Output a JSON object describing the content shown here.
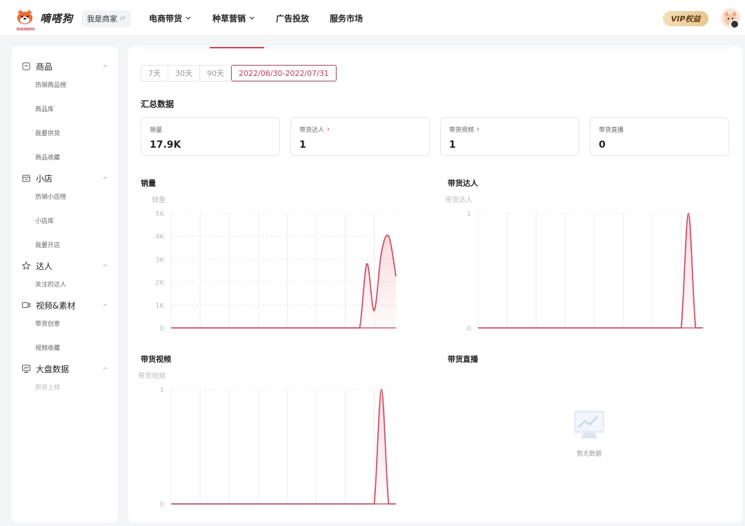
{
  "header": {
    "logo_text": "嘀嗒狗",
    "logo_sub": "DIDADOG",
    "role_label": "我是商家",
    "nav": [
      {
        "label": "电商带货",
        "dropdown": true
      },
      {
        "label": "种草营销",
        "dropdown": true
      },
      {
        "label": "广告投放",
        "dropdown": false
      },
      {
        "label": "服务市场",
        "dropdown": false
      }
    ],
    "vip_label": "VIP权益"
  },
  "sidebar": {
    "groups": [
      {
        "label": "商品",
        "icon": "product-icon",
        "items": [
          "热销商品榜",
          "商品库",
          "我要供货",
          "商品收藏"
        ]
      },
      {
        "label": "小店",
        "icon": "shop-icon",
        "items": [
          "热销小店榜",
          "小店库",
          "我要开店"
        ]
      },
      {
        "label": "达人",
        "icon": "influencer-icon",
        "items": [
          "关注的达人"
        ]
      },
      {
        "label": "视频&素材",
        "icon": "video-icon",
        "items": [
          "带货创意",
          "视频收藏"
        ]
      },
      {
        "label": "大盘数据",
        "icon": "dashboard-icon",
        "items": [
          "即将上线"
        ]
      }
    ]
  },
  "main": {
    "date_options": [
      "7天",
      "30天",
      "90天"
    ],
    "date_range": "2022/06/30-2022/07/31",
    "summary_title": "汇总数据",
    "cards": [
      {
        "label": "销量",
        "value": "17.9K",
        "has_more": false
      },
      {
        "label": "带货达人",
        "value": "1",
        "has_more": true
      },
      {
        "label": "带货视频",
        "value": "1",
        "has_more": true
      },
      {
        "label": "带货直播",
        "value": "0",
        "has_more": false
      }
    ],
    "more_symbol": "›",
    "empty_text": "暂无数据"
  },
  "chart_data": [
    {
      "type": "area",
      "title": "销量",
      "ylabel": "销量",
      "y_ticks": [
        "0",
        "1K",
        "2K",
        "3K",
        "4K",
        "5K"
      ],
      "ylim": [
        0,
        5000
      ],
      "x": [
        0,
        1,
        2,
        3,
        4,
        5,
        6,
        7,
        8,
        9,
        10,
        11,
        12,
        13,
        14,
        15,
        16,
        17,
        18,
        19,
        20,
        21,
        22,
        23,
        24,
        25,
        26,
        27,
        28,
        29,
        30,
        31
      ],
      "values": [
        0,
        0,
        0,
        0,
        0,
        0,
        0,
        0,
        0,
        0,
        0,
        0,
        0,
        0,
        0,
        0,
        0,
        0,
        0,
        0,
        0,
        0,
        0,
        0,
        0,
        0,
        0,
        2800,
        750,
        3300,
        4000,
        2250
      ],
      "grid": true
    },
    {
      "type": "area",
      "title": "带货达人",
      "ylabel": "带货达人",
      "y_ticks": [
        "0",
        "1"
      ],
      "ylim": [
        0,
        1
      ],
      "x": [
        0,
        1,
        2,
        3,
        4,
        5,
        6,
        7,
        8,
        9,
        10,
        11,
        12,
        13,
        14,
        15,
        16,
        17,
        18,
        19,
        20,
        21,
        22,
        23,
        24,
        25,
        26,
        27,
        28,
        29,
        30,
        31
      ],
      "values": [
        0,
        0,
        0,
        0,
        0,
        0,
        0,
        0,
        0,
        0,
        0,
        0,
        0,
        0,
        0,
        0,
        0,
        0,
        0,
        0,
        0,
        0,
        0,
        0,
        0,
        0,
        0,
        0,
        0,
        1,
        0,
        0
      ],
      "grid": true
    },
    {
      "type": "area",
      "title": "带货视频",
      "ylabel": "带货视频",
      "y_ticks": [
        "0",
        "1"
      ],
      "ylim": [
        0,
        1
      ],
      "x": [
        0,
        1,
        2,
        3,
        4,
        5,
        6,
        7,
        8,
        9,
        10,
        11,
        12,
        13,
        14,
        15,
        16,
        17,
        18,
        19,
        20,
        21,
        22,
        23,
        24,
        25,
        26,
        27,
        28,
        29,
        30,
        31
      ],
      "values": [
        0,
        0,
        0,
        0,
        0,
        0,
        0,
        0,
        0,
        0,
        0,
        0,
        0,
        0,
        0,
        0,
        0,
        0,
        0,
        0,
        0,
        0,
        0,
        0,
        0,
        0,
        0,
        0,
        0,
        1,
        0,
        0
      ],
      "grid": true
    },
    {
      "type": "area",
      "title": "带货直播",
      "values": []
    }
  ]
}
